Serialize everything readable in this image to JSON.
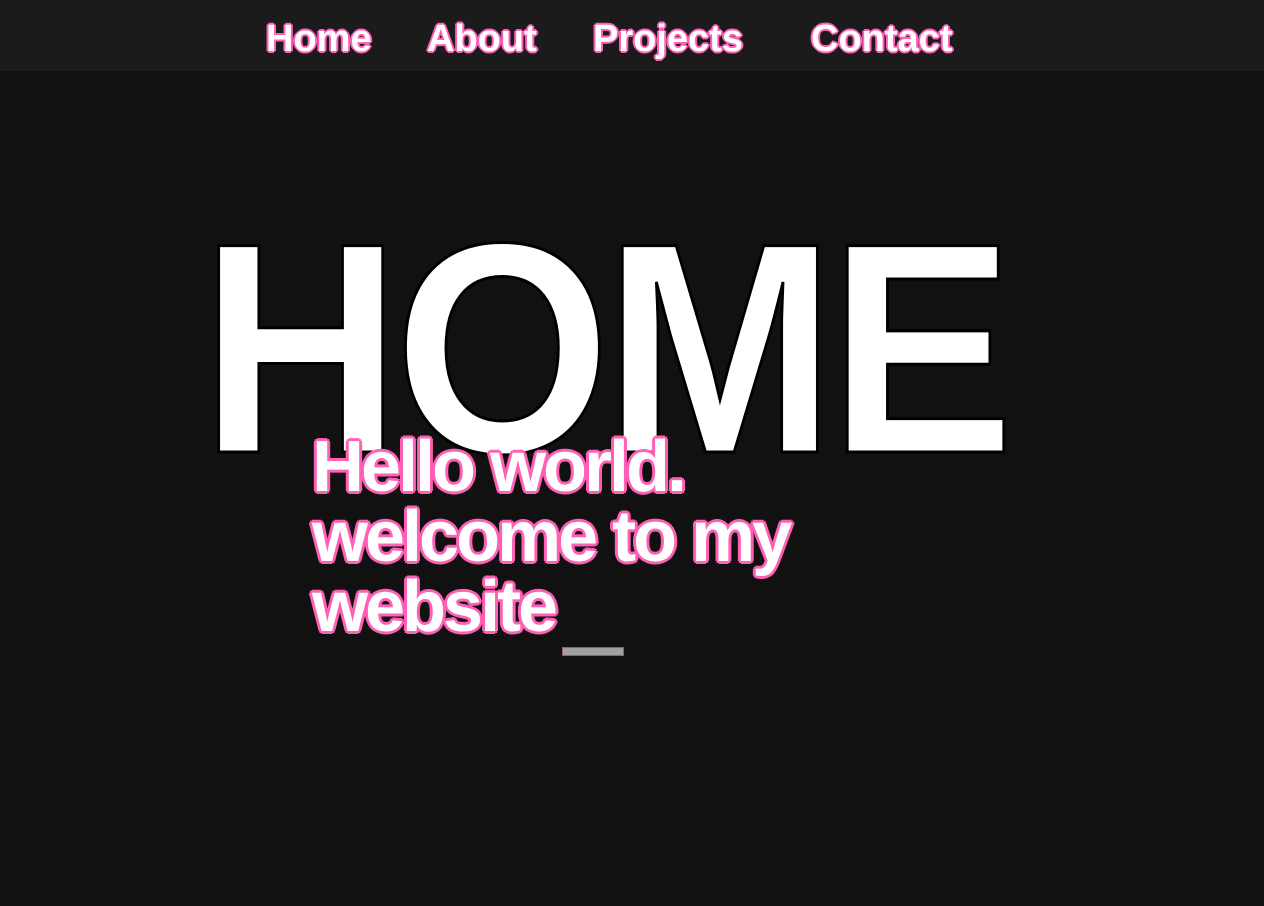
{
  "nav": {
    "items": [
      {
        "label": "Home"
      },
      {
        "label": "About"
      },
      {
        "label": "Projects"
      },
      {
        "label": "Contact"
      }
    ]
  },
  "hero": {
    "title": "HOME",
    "greeting_line1": "Hello world.",
    "greeting_line2": "welcome to my",
    "greeting_line3": "website"
  },
  "colors": {
    "accent": "#ff5fb4",
    "background": "#111111",
    "nav_background": "#1b1b1b"
  }
}
